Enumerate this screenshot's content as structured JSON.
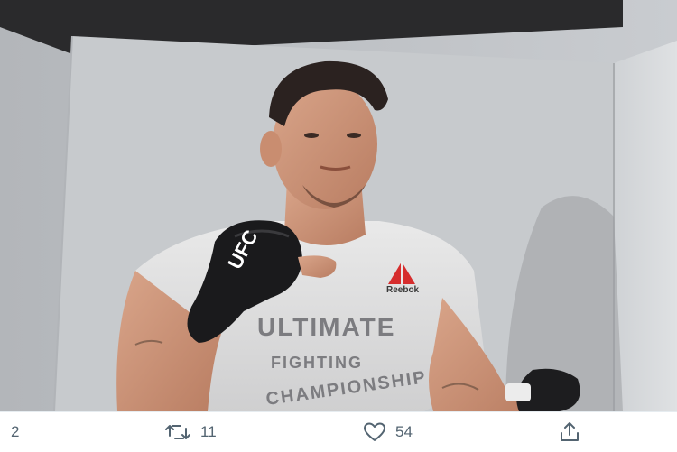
{
  "tweet": {
    "media": {
      "kind": "photo",
      "glove_text": "UFC",
      "shirt_brand": "Reebok",
      "shirt_lines": [
        "ULTIMATE",
        "FIGHTING",
        "CHAMPIONSHIP"
      ]
    },
    "actions": {
      "reply_count": "2",
      "retweet_count": "11",
      "like_count": "54"
    }
  },
  "colors": {
    "action_gray": "#536471",
    "reebok_red": "#d62d2d",
    "wall": "#c3c6ca"
  },
  "icons": {
    "reply": "reply-icon",
    "retweet": "retweet-icon",
    "like": "heart-icon",
    "share": "share-icon"
  }
}
